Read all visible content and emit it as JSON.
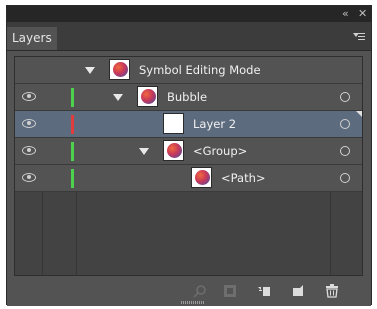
{
  "window": {
    "collapse_glyph": "«",
    "close_glyph": "✕"
  },
  "panel": {
    "tab_label": "Layers",
    "menu_icon": "panel-menu-icon"
  },
  "rows": [
    {
      "name": "Symbol Editing Mode",
      "visible": false,
      "color": "",
      "expanded": true,
      "thumb": "gradient-circle",
      "target": false,
      "selected": false
    },
    {
      "name": "Bubble",
      "visible": true,
      "color": "#4ed24e",
      "expanded": true,
      "thumb": "gradient-circle",
      "target": true,
      "selected": false
    },
    {
      "name": "Layer 2",
      "visible": true,
      "color": "#e03e3e",
      "expanded": false,
      "thumb": "blank",
      "target": true,
      "selected": true
    },
    {
      "name": "<Group>",
      "visible": true,
      "color": "#4ed24e",
      "expanded": true,
      "thumb": "gradient-circle",
      "target": true,
      "selected": false
    },
    {
      "name": "<Path>",
      "visible": true,
      "color": "#4ed24e",
      "expanded": false,
      "thumb": "gradient-circle",
      "target": true,
      "selected": false
    }
  ],
  "bottom_toolbar": {
    "icons": [
      "locate-object-icon",
      "make-clipping-mask-icon",
      "create-sublayer-icon",
      "create-new-layer-icon",
      "delete-icon"
    ]
  },
  "colors": {
    "panel_bg": "#535353",
    "selected_row": "#5d6b7e",
    "titlebar": "#262626"
  }
}
